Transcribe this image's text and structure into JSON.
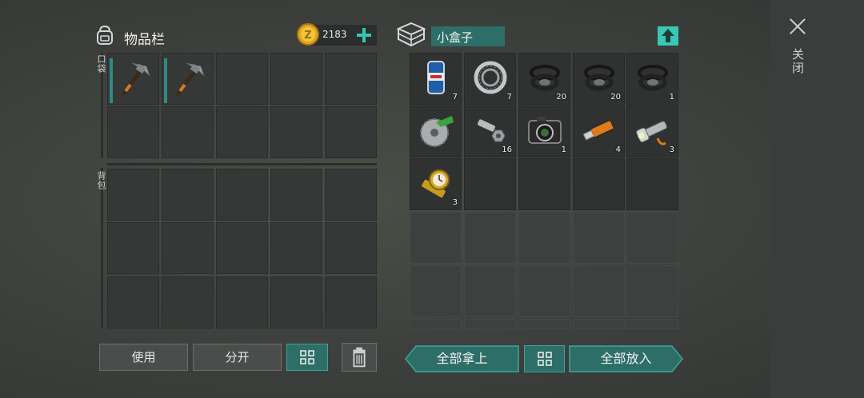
{
  "inventory": {
    "title": "物品栏",
    "coins": "2183",
    "pocket_label": "口袋",
    "backpack_label": "背包",
    "pocket_items": [
      {
        "name": "pickaxe",
        "equipped": true
      },
      {
        "name": "pickaxe",
        "equipped": true
      }
    ]
  },
  "container": {
    "title": "小盒子",
    "items": [
      {
        "name": "beer-can",
        "count": "7"
      },
      {
        "name": "bearing",
        "count": "7"
      },
      {
        "name": "rubber-ring",
        "count": "20"
      },
      {
        "name": "rubber-ring",
        "count": "20"
      },
      {
        "name": "rubber-ring",
        "count": "1"
      },
      {
        "name": "saw-blade",
        "count": ""
      },
      {
        "name": "bolt-nut",
        "count": "16"
      },
      {
        "name": "camera",
        "count": "1"
      },
      {
        "name": "usb-drive",
        "count": "4"
      },
      {
        "name": "flashlight",
        "count": "3"
      },
      {
        "name": "gold-watch",
        "count": "3"
      }
    ]
  },
  "buttons": {
    "use": "使用",
    "split": "分开",
    "take_all": "全部拿上",
    "put_all": "全部放入",
    "close": "关闭"
  },
  "colors": {
    "accent": "#35c7b3",
    "teal_dark": "#2d6e68",
    "background": "#3d403c"
  }
}
